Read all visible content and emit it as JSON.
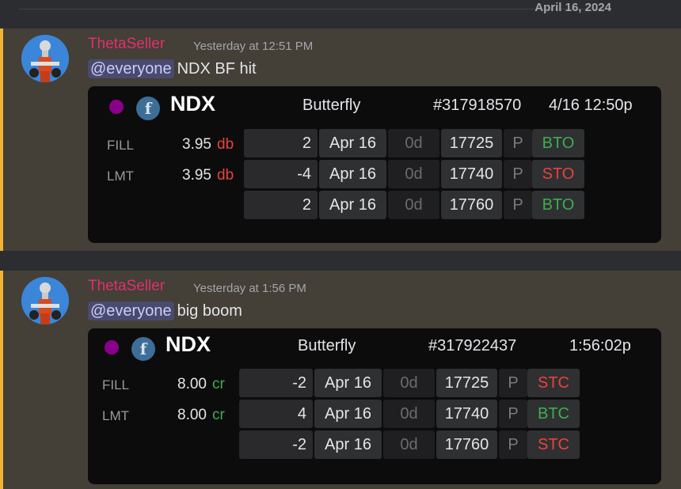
{
  "date_divider": "April 16, 2024",
  "messages": [
    {
      "author": "ThetaSeller",
      "timestamp": "Yesterday at 12:51 PM",
      "mention": "@everyone",
      "text": "NDX BF hit",
      "card": {
        "symbol": "NDX",
        "badge": "f",
        "strategy": "Butterfly",
        "order_id": "#317918570",
        "time": "4/16 12:50p",
        "fill": {
          "label": "FILL",
          "price": "3.95",
          "unit": "db"
        },
        "limit": {
          "label": "LMT",
          "price": "3.95",
          "unit": "db"
        },
        "legs": [
          {
            "qty": "2",
            "date": "Apr 16",
            "dte": "0d",
            "strike": "17725",
            "pc": "P",
            "action": "BTO"
          },
          {
            "qty": "-4",
            "date": "Apr 16",
            "dte": "0d",
            "strike": "17740",
            "pc": "P",
            "action": "STO"
          },
          {
            "qty": "2",
            "date": "Apr 16",
            "dte": "0d",
            "strike": "17760",
            "pc": "P",
            "action": "BTO"
          }
        ]
      }
    },
    {
      "author": "ThetaSeller",
      "timestamp": "Yesterday at 1:56 PM",
      "mention": "@everyone",
      "text": "big boom",
      "card": {
        "symbol": "NDX",
        "badge": "f",
        "strategy": "Butterfly",
        "order_id": "#317922437",
        "time": "1:56:02p",
        "fill": {
          "label": "FILL",
          "price": "8.00",
          "unit": "cr"
        },
        "limit": {
          "label": "LMT",
          "price": "8.00",
          "unit": "cr"
        },
        "legs": [
          {
            "qty": "-2",
            "date": "Apr 16",
            "dte": "0d",
            "strike": "17725",
            "pc": "P",
            "action": "STC"
          },
          {
            "qty": "4",
            "date": "Apr 16",
            "dte": "0d",
            "strike": "17740",
            "pc": "P",
            "action": "BTC"
          },
          {
            "qty": "-2",
            "date": "Apr 16",
            "dte": "0d",
            "strike": "17760",
            "pc": "P",
            "action": "STC"
          }
        ]
      }
    }
  ],
  "colors": {
    "author": "#e0306e",
    "debit": "#e8443a",
    "credit": "#3fae4f",
    "buy": "#3fae4f",
    "sell": "#e8443a"
  }
}
